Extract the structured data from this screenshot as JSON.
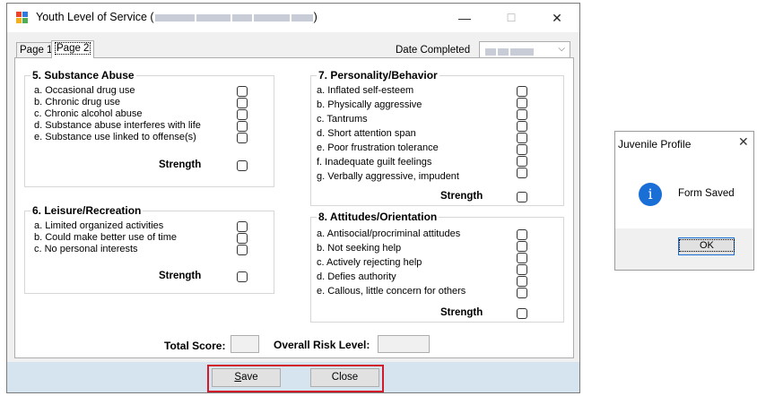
{
  "window": {
    "title_prefix": "Youth Level of Service (",
    "title_suffix": ")",
    "min_symbol": "—",
    "max_symbol": "☐",
    "close_symbol": "✕"
  },
  "tabs": [
    {
      "label": "Page 1"
    },
    {
      "label": "Page 2"
    }
  ],
  "date": {
    "label": "Date Completed",
    "arrow": "⌵"
  },
  "sections": {
    "substance": {
      "title": "5. Substance Abuse",
      "items": [
        "a. Occasional drug use",
        "b. Chronic drug use",
        "c. Chronic alcohol abuse",
        "d. Substance abuse interferes with life",
        "e. Substance use linked to offense(s)"
      ],
      "strength": "Strength"
    },
    "leisure": {
      "title": "6. Leisure/Recreation",
      "items": [
        "a. Limited organized activities",
        "b. Could make better use of time",
        "c. No personal interests"
      ],
      "strength": "Strength"
    },
    "personality": {
      "title": "7. Personality/Behavior",
      "items": [
        "a. Inflated self-esteem",
        "b. Physically aggressive",
        "c. Tantrums",
        "d. Short attention span",
        "e. Poor frustration tolerance",
        "f. Inadequate guilt feelings",
        "g. Verbally aggressive, impudent"
      ],
      "strength": "Strength"
    },
    "attitudes": {
      "title": "8. Attitudes/Orientation",
      "items": [
        "a. Antisocial/procriminal attitudes",
        "b. Not seeking help",
        "c. Actively rejecting help",
        "d. Defies authority",
        "e. Callous, little concern for others"
      ],
      "strength": "Strength"
    }
  },
  "scores": {
    "total_label": "Total Score:",
    "risk_label": "Overall Risk Level:"
  },
  "buttons": {
    "save": "Save",
    "close": "Close"
  },
  "dialog": {
    "title": "Juvenile Profile",
    "close_symbol": "✕",
    "icon_glyph": "i",
    "message": "Form Saved",
    "ok": "OK"
  },
  "colors": {
    "accent": "#1a6fd6",
    "highlight_frame": "#d11a2a",
    "bottom_bar": "#d6e4f0"
  }
}
